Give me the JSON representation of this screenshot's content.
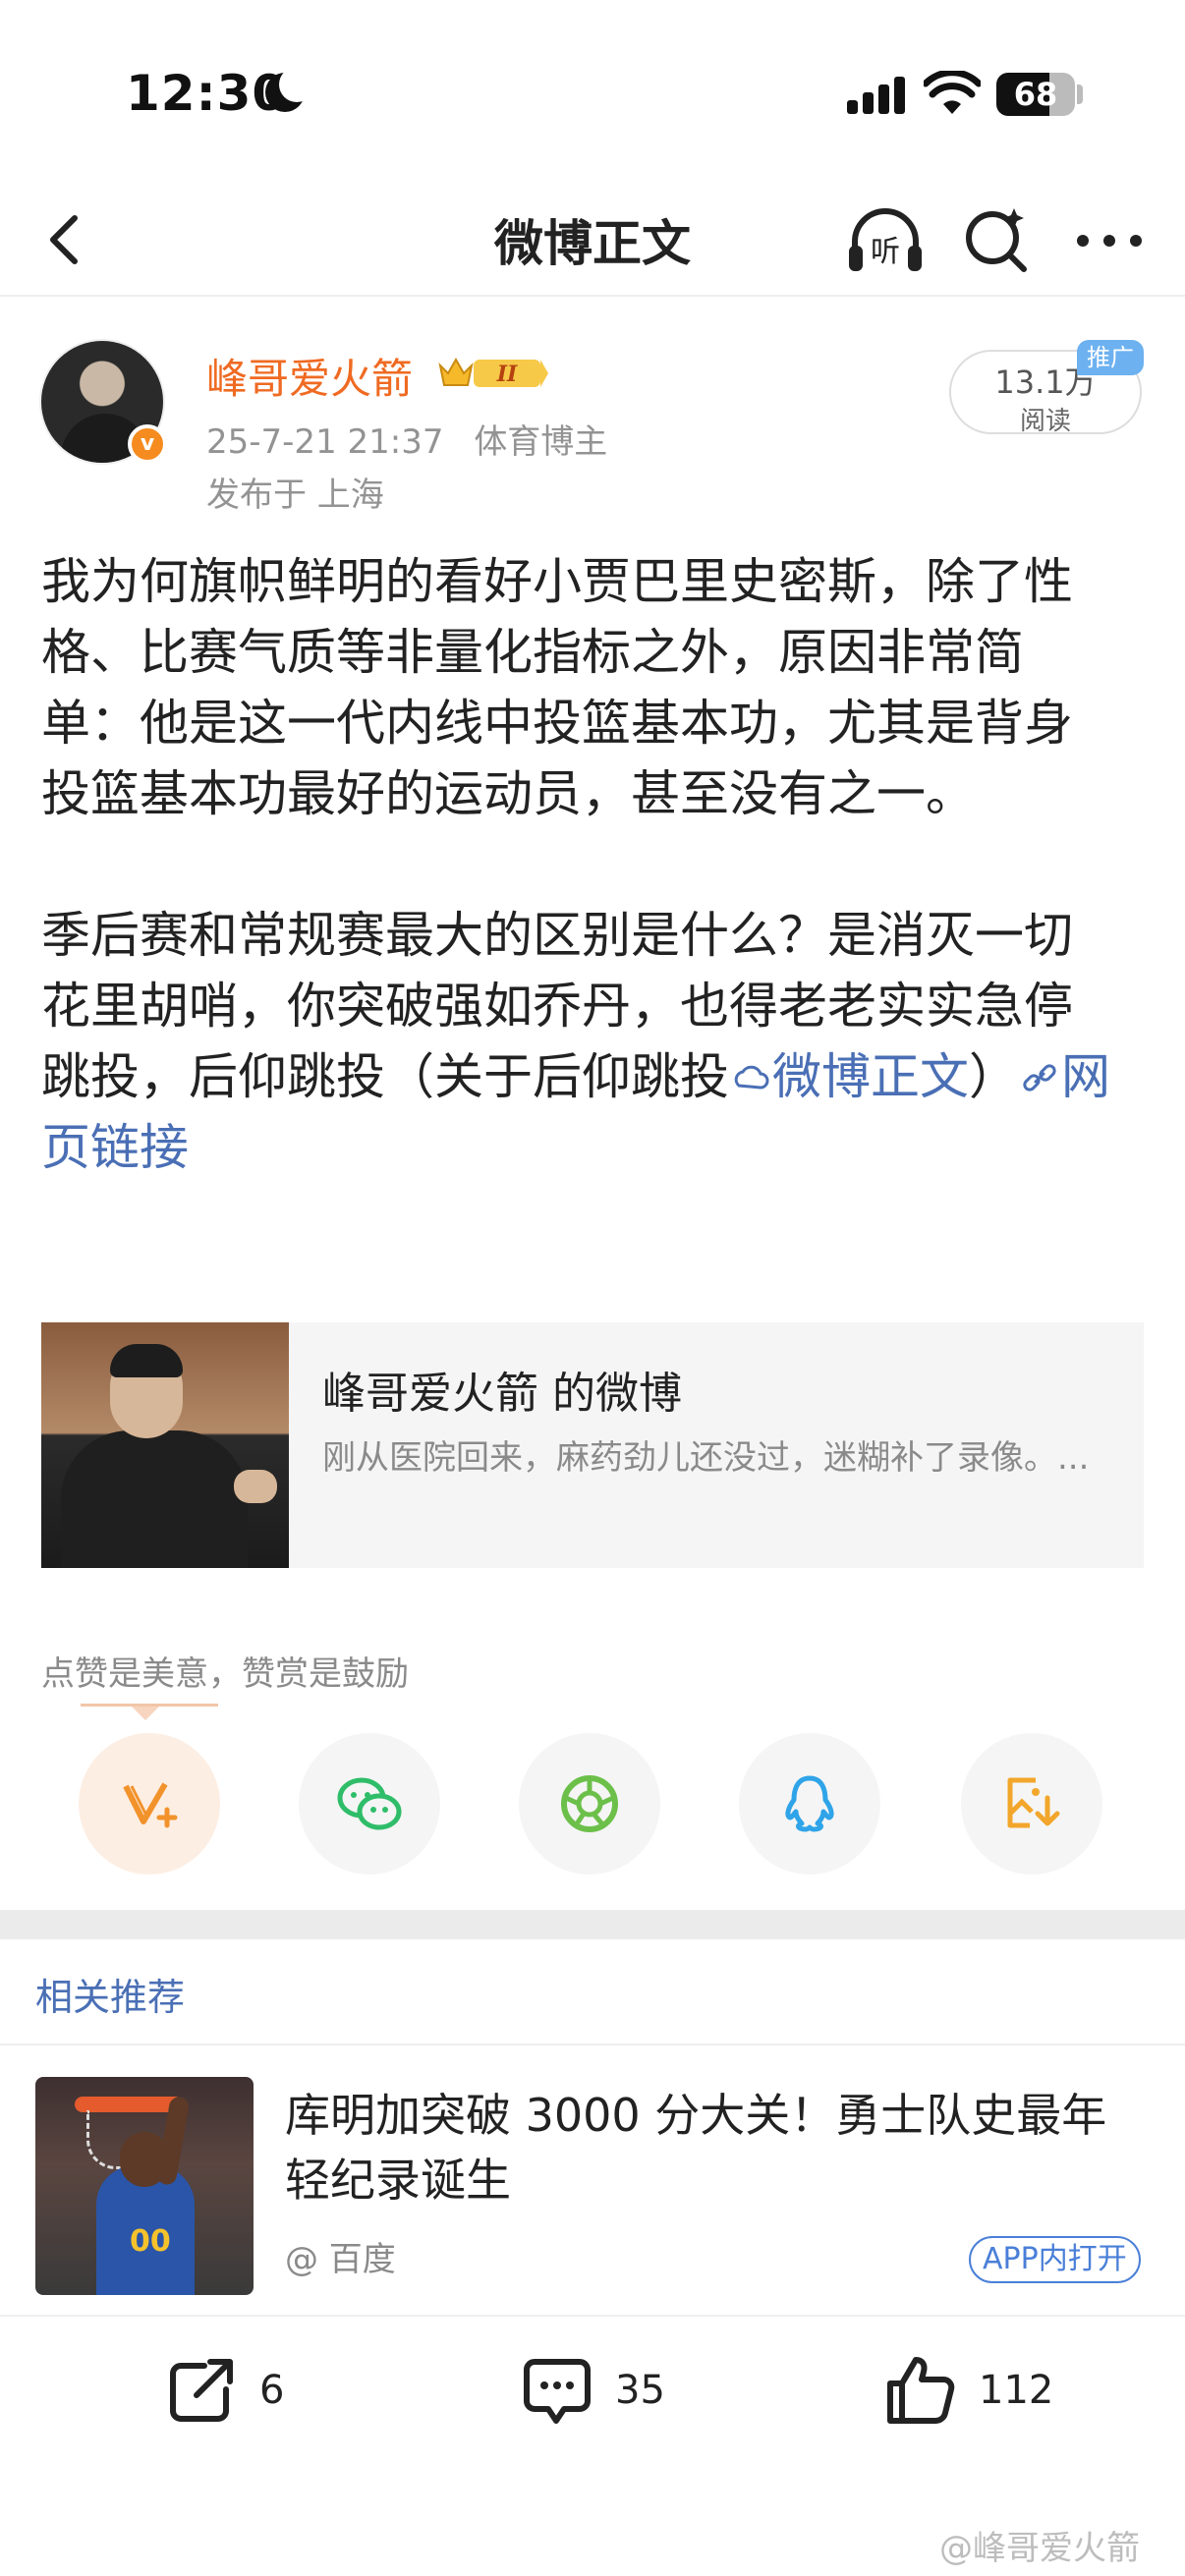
{
  "status_bar": {
    "time": "12:30",
    "battery": "68",
    "battery_level": 0.68
  },
  "nav": {
    "title": "微博正文",
    "listen_label": "听"
  },
  "author": {
    "name": "峰哥爱火箭",
    "level": "II",
    "verified_mark": "v",
    "date": "25-7-21 21:37",
    "role": "体育博主",
    "location": "发布于 上海",
    "reads": "13.1万",
    "reads_label": "阅读",
    "promo_tag": "推广"
  },
  "post": {
    "para1": "我为何旗帜鲜明的看好小贾巴里史密斯，除了性格、比赛气质等非量化指标之外，原因非常简单：他是这一代内线中投篮基本功，尤其是背身投篮基本功最好的运动员，甚至没有之一。",
    "para2_text": "季后赛和常规赛最大的区别是什么？是消灭一切花里胡哨，你突破强如乔丹，也得老老实实急停跳投，后仰跳投（关于后仰跳投",
    "link1": "微博正文",
    "para2_close": "）",
    "link2": "网页链接"
  },
  "card": {
    "title": "峰哥爱火箭 的微博",
    "desc": "刚从医院回来，麻药劲儿还没过，迷糊补了录像。..."
  },
  "reward": {
    "label": "点赞是美意，赞赏是鼓励"
  },
  "share_icons": [
    "reward-v-plus-icon",
    "wechat-icon",
    "moments-icon",
    "qq-icon",
    "save-image-icon"
  ],
  "related": {
    "section_title": "相关推荐",
    "headline": "库明加突破 3000 分大关！勇士队史最年轻纪录诞生",
    "source": "@ 百度",
    "open_app": "APP内打开",
    "jersey_number": "00"
  },
  "actions": {
    "reposts": "6",
    "comments": "35",
    "likes": "112"
  },
  "watermark": "@峰哥爱火箭",
  "colors": {
    "author_name": "#ef6a22",
    "link": "#4a6fb5",
    "muted": "#939393"
  }
}
